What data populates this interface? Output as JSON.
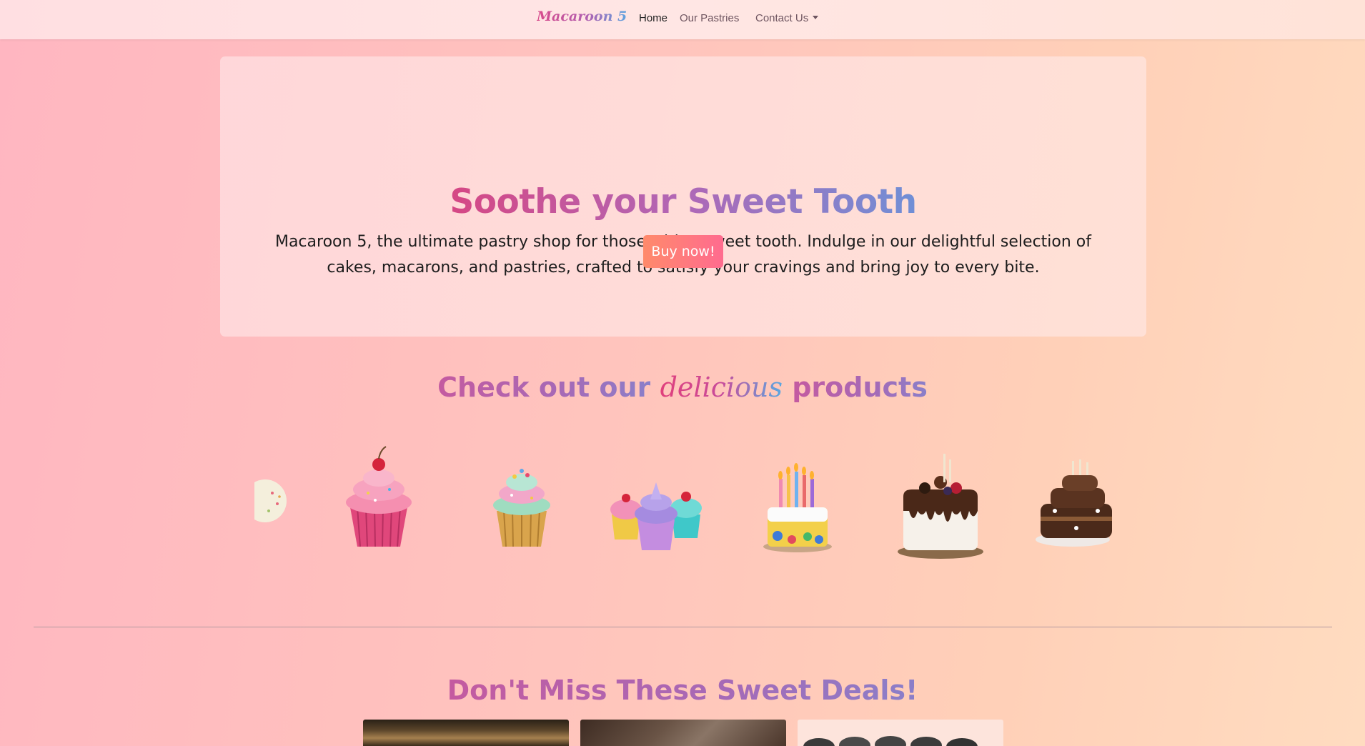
{
  "navbar": {
    "brand": "Macaroon 5",
    "items": [
      {
        "label": "Home"
      },
      {
        "label": "Our Pastries"
      },
      {
        "label": "Contact Us"
      }
    ]
  },
  "hero": {
    "title": "Soothe your Sweet Tooth",
    "text": "Macaroon 5, the ultimate pastry shop for those with a sweet tooth. Indulge in our delightful selection of cakes, macarons, and pastries, crafted to satisfy your cravings and bring joy to every bite.",
    "button": "Buy now!"
  },
  "products": {
    "heading_start": "Check out our",
    "heading_script": "delicious",
    "heading_end": "products",
    "items": [
      {
        "icon": "macaron-icon"
      },
      {
        "icon": "pink-cherry-cupcake-icon"
      },
      {
        "icon": "mint-sprinkle-cupcake-icon"
      },
      {
        "icon": "three-cupcakes-icon"
      },
      {
        "icon": "birthday-cake-icon"
      },
      {
        "icon": "chocolate-drip-cake-icon"
      },
      {
        "icon": "chocolate-layer-cake-icon"
      }
    ]
  },
  "deals": {
    "heading": "Don't Miss These Sweet Deals!"
  },
  "colors": {
    "accent_pink": "#d64784",
    "accent_purple": "#b067b6",
    "accent_blue": "#6f8fd6",
    "button": "#ff7a7c"
  }
}
